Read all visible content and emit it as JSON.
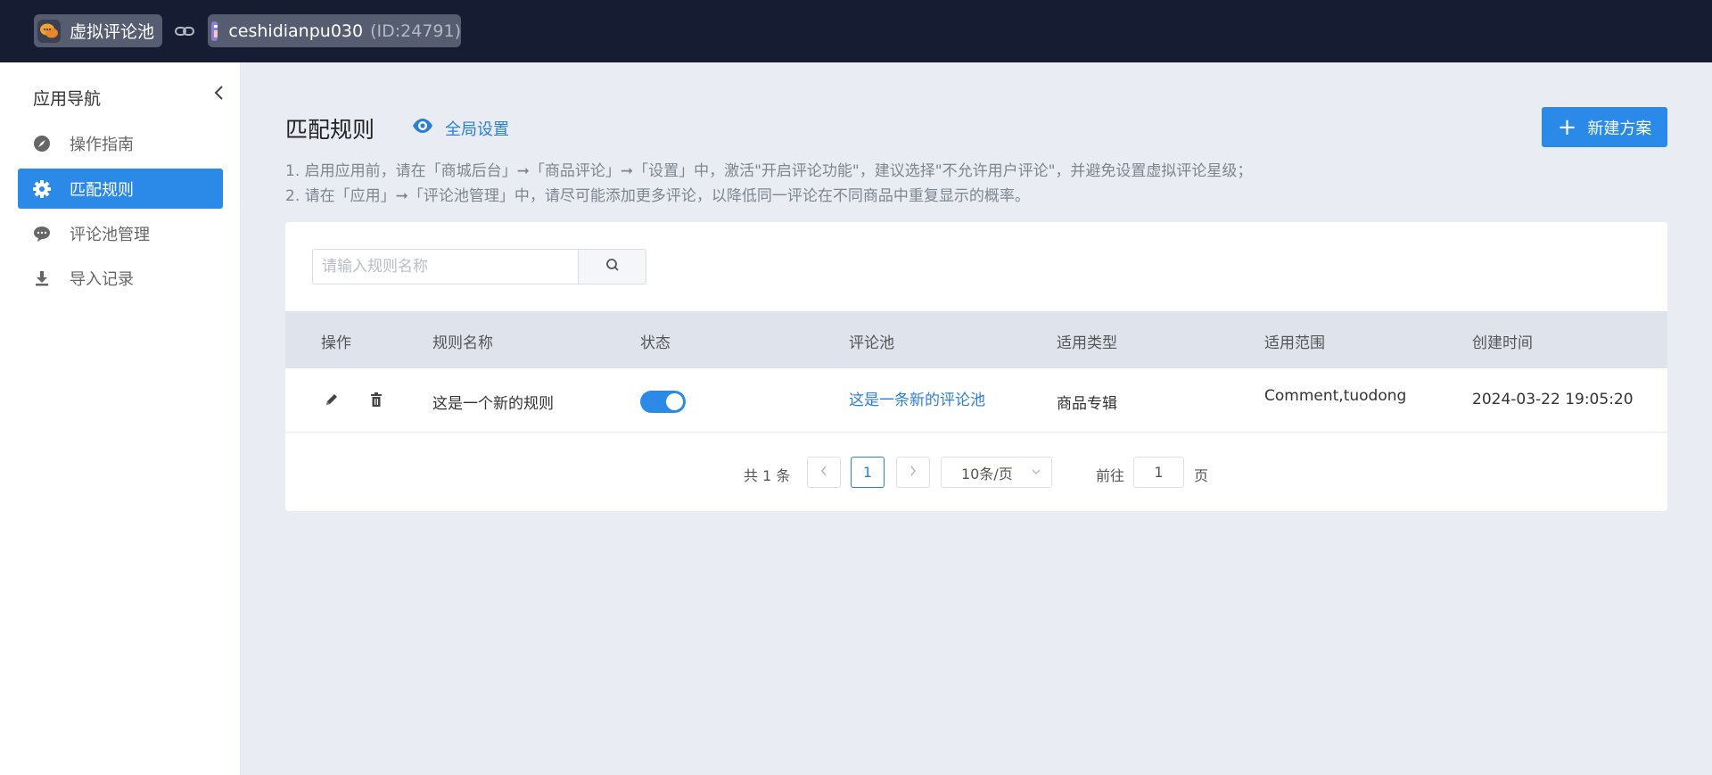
{
  "topbar": {
    "app_name": "虚拟评论池",
    "shop_name": "ceshidianpu030",
    "shop_id": "(ID:24791)"
  },
  "sidebar": {
    "title": "应用导航",
    "items": [
      {
        "label": "操作指南",
        "icon": "compass-icon",
        "active": false
      },
      {
        "label": "匹配规则",
        "icon": "gear-icon",
        "active": true
      },
      {
        "label": "评论池管理",
        "icon": "chat-bubble-icon",
        "active": false
      },
      {
        "label": "导入记录",
        "icon": "download-icon",
        "active": false
      }
    ]
  },
  "main": {
    "title": "匹配规则",
    "global_settings": "全局设置",
    "new_button": "新建方案",
    "tips": [
      "1. 启用应用前，请在「商城后台」➞「商品评论」➞「设置」中，激活\"开启评论功能\"，建议选择\"不允许用户评论\"，并避免设置虚拟评论星级；",
      "2. 请在「应用」➞「评论池管理」中，请尽可能添加更多评论，以降低同一评论在不同商品中重复显示的概率。"
    ]
  },
  "search": {
    "placeholder": "请输入规则名称",
    "value": ""
  },
  "table": {
    "columns": [
      "操作",
      "规则名称",
      "状态",
      "评论池",
      "适用类型",
      "适用范围",
      "创建时间"
    ],
    "rows": [
      {
        "name": "这是一个新的规则",
        "enabled": true,
        "pool": "这是一条新的评论池",
        "type": "商品专辑",
        "scope": "Comment,tuodong",
        "created": "2024-03-22 19:05:20"
      }
    ]
  },
  "pagination": {
    "total": "共 1 条",
    "current_page": "1",
    "page_size": "10条/页",
    "goto_label": "前往",
    "goto_value": "1",
    "page_unit": "页"
  },
  "colors": {
    "primary": "#2b8ae8",
    "topbar": "#161d33",
    "link": "#2b7fd8"
  }
}
